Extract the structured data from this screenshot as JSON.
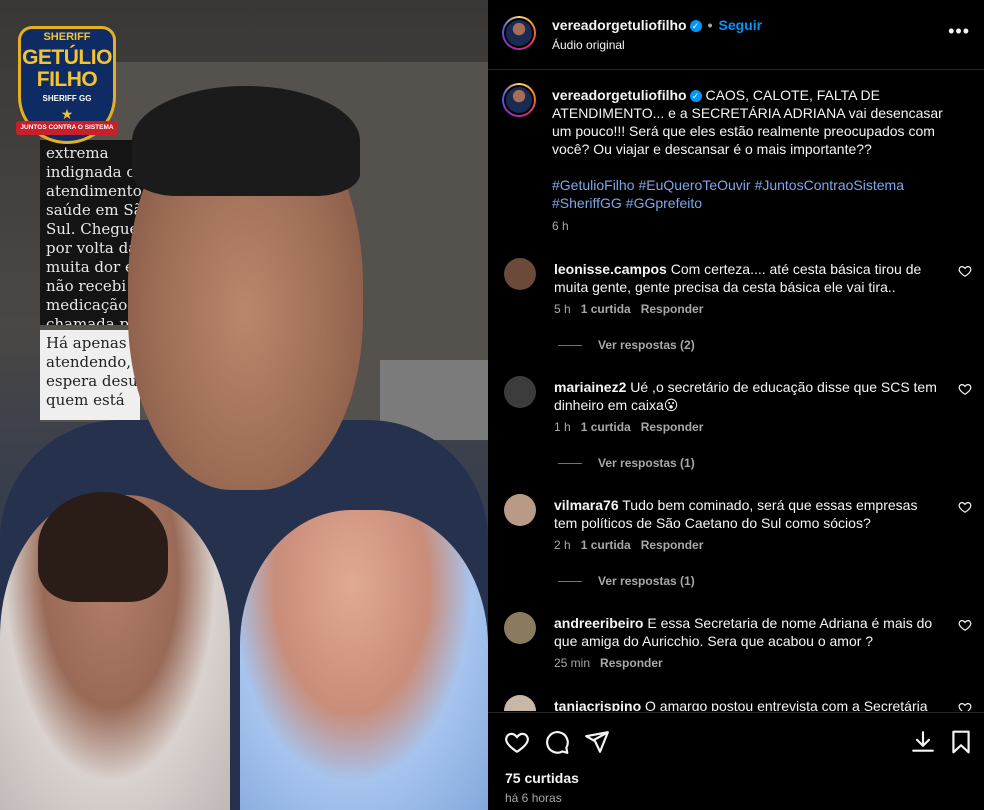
{
  "media": {
    "badge": {
      "top": "SHERIFF",
      "line1": "GETÚLIO",
      "line2": "FILHO",
      "sub": "SHERIFF GG",
      "ribbon": "JUNTOS CONTRA O SISTEMA"
    },
    "sign_dark": "extrema\nindignada com\natendimento\nsaúde em São\nSul. Chegue\npor volta da\nmuita dor e\nnão recebi\nmedicação\nchamada pa\natendiment",
    "sign_light": "Há apenas u\natendendo, o\nespera desum\nquem está"
  },
  "header": {
    "username": "vereadorgetuliofilho",
    "verified_mark": "✓",
    "separator": "•",
    "follow_label": "Seguir",
    "audio": "Áudio original",
    "more_label": "•••"
  },
  "caption": {
    "username": "vereadorgetuliofilho",
    "text": "CAOS, CALOTE, FALTA DE ATENDIMENTO... e a SECRETÁRIA ADRIANA vai desencasar um pouco!!! Será que eles estão realmente preocupados com você? Ou viajar e descansar é o mais importante??",
    "hashtags": [
      "#GetulioFilho",
      "#EuQueroTeOuvir",
      "#JuntosContraoSistema",
      "#SheriffGG",
      "#GGprefeito"
    ],
    "time": "6 h"
  },
  "comments": [
    {
      "username": "leonisse.campos",
      "text": "Com certeza.... até cesta básica tirou de muita gente, gente precisa da cesta básica ele vai tira..",
      "time": "5 h",
      "likes": "1 curtida",
      "reply": "Responder",
      "view_replies": "Ver respostas (2)",
      "avatar_color": "#6b4a3a"
    },
    {
      "username": "mariainez2",
      "text": "Ué ,o secretário de educação disse que SCS tem dinheiro em caixa😮",
      "time": "1 h",
      "likes": "1 curtida",
      "reply": "Responder",
      "view_replies": "Ver respostas (1)",
      "avatar_color": "#3c3c3c"
    },
    {
      "username": "vilmara76",
      "text": "Tudo bem cominado, será que essas empresas tem políticos de São Caetano do Sul como sócios?",
      "time": "2 h",
      "likes": "1 curtida",
      "reply": "Responder",
      "view_replies": "Ver respostas (1)",
      "avatar_color": "#b89a86"
    },
    {
      "username": "andreeribeiro",
      "text": "E essa Secretaria de nome Adriana é mais do que amiga do Auricchio. Sera que acabou o amor ?",
      "time": "25 min",
      "reply": "Responder",
      "avatar_color": "#8a7a5e"
    },
    {
      "username": "taniacrispino",
      "text": "O amargo postou entrevista com a Secretária",
      "avatar_color": "#c9b7a8"
    }
  ],
  "footer": {
    "likes": "75 curtidas",
    "ago": "há 6 horas"
  },
  "colors": {
    "accent": "#0095f6",
    "hashtag": "#7ea7e8",
    "muted": "#a8a8a8",
    "background": "#000000"
  },
  "icons": [
    "heart-icon",
    "comment-icon",
    "share-icon",
    "save-icon",
    "more-icon",
    "verified-icon"
  ]
}
